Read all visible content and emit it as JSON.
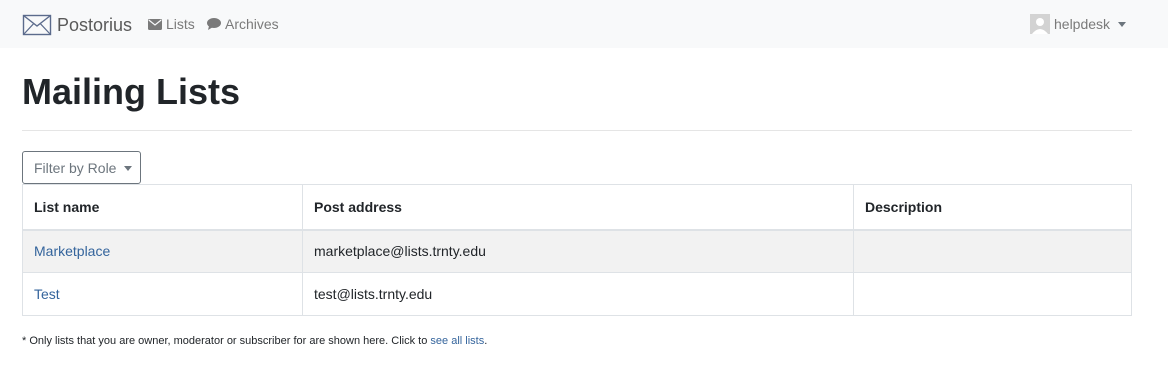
{
  "navbar": {
    "brand": "Postorius",
    "links": [
      {
        "label": "Lists",
        "icon": "envelope-icon"
      },
      {
        "label": "Archives",
        "icon": "comment-icon"
      }
    ],
    "user": "helpdesk"
  },
  "page": {
    "title": "Mailing Lists"
  },
  "filter": {
    "label": "Filter by Role"
  },
  "table": {
    "headers": [
      "List name",
      "Post address",
      "Description"
    ],
    "rows": [
      {
        "name": "Marketplace",
        "post_address": "marketplace@lists.trnty.edu",
        "description": ""
      },
      {
        "name": "Test",
        "post_address": "test@lists.trnty.edu",
        "description": ""
      }
    ]
  },
  "footnote": {
    "text": "* Only lists that you are owner, moderator or subscriber for are shown here. Click to ",
    "link": "see all lists",
    "end": "."
  },
  "colors": {
    "navbar_bg": "#f8f9fa",
    "link": "#34649c",
    "stripe": "#f2f2f2",
    "border": "#dee2e6"
  }
}
